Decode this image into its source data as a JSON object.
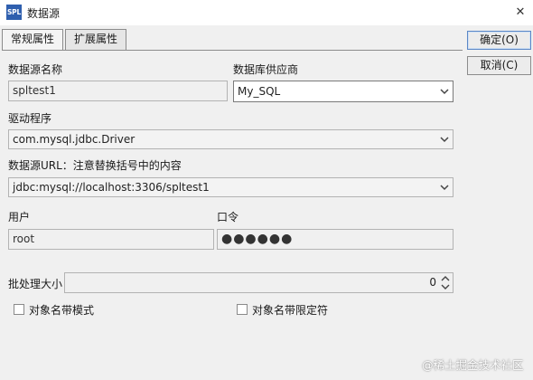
{
  "window": {
    "icon_text": "SPL",
    "title": "数据源",
    "close_glyph": "✕"
  },
  "tabs": [
    {
      "label": "常规属性",
      "active": true
    },
    {
      "label": "扩展属性",
      "active": false
    }
  ],
  "buttons": {
    "ok": "确定(O)",
    "cancel": "取消(C)"
  },
  "form": {
    "name_label": "数据源名称",
    "name_value": "spltest1",
    "vendor_label": "数据库供应商",
    "vendor_value": "My_SQL",
    "driver_label": "驱动程序",
    "driver_value": "com.mysql.jdbc.Driver",
    "url_label": "数据源URL：注意替换括号中的内容",
    "url_value": "jdbc:mysql://localhost:3306/spltest1",
    "user_label": "用户",
    "user_value": "root",
    "password_label": "口令",
    "password_value": "●●●●●●",
    "batch_label": "批处理大小",
    "batch_value": "0",
    "object_name_mode_label": "对象名带模式",
    "object_name_mode_checked": false,
    "object_name_quote_label": "对象名带限定符",
    "object_name_quote_checked": false
  },
  "watermark": "@稀土掘金技术社区",
  "colors": {
    "window_bg": "#f0f0f0",
    "app_icon": "#2f5fae",
    "default_button_border": "#5b87c6"
  }
}
